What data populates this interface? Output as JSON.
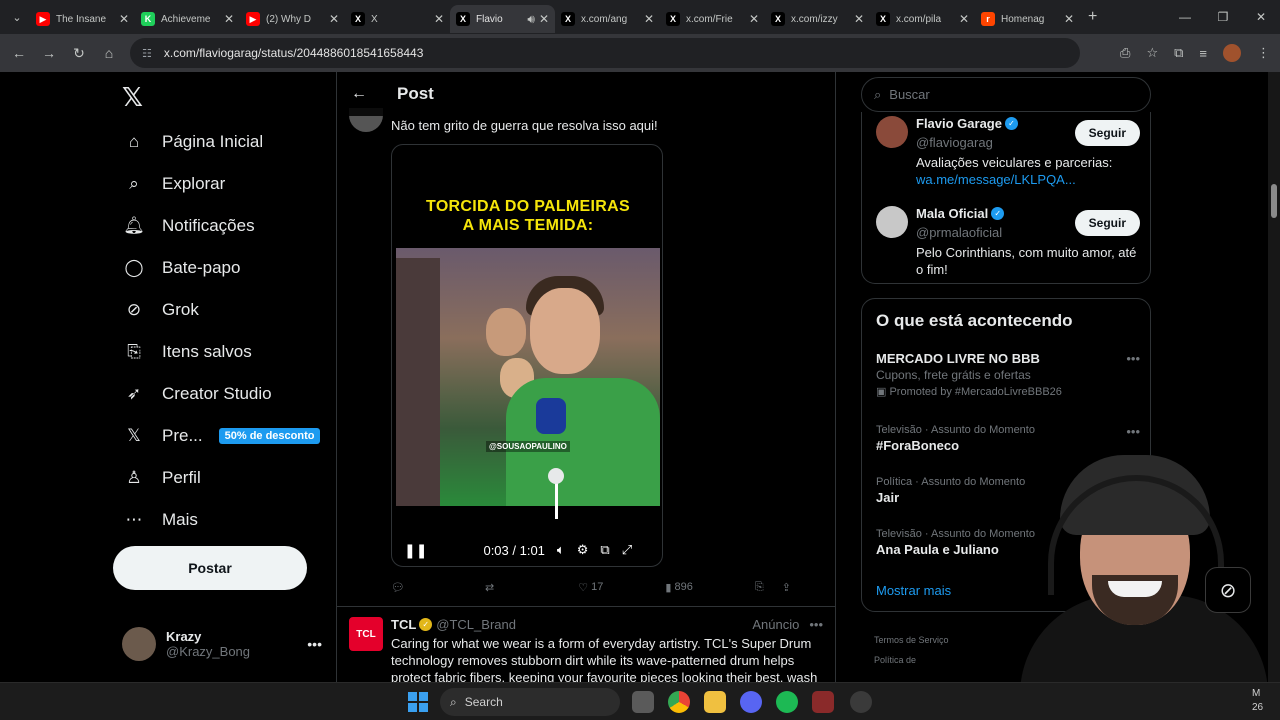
{
  "browser": {
    "tabs": [
      {
        "title": "The Insane",
        "fav": "yt",
        "color": "#ff0000"
      },
      {
        "title": "Achieveme",
        "fav": "K",
        "color": "#1fcf5a"
      },
      {
        "title": "(2) Why D",
        "fav": "yt",
        "color": "#ff0000"
      },
      {
        "title": "X",
        "fav": "X",
        "color": "#000000"
      },
      {
        "title": "Flavio",
        "fav": "X",
        "color": "#000000",
        "active": true
      },
      {
        "title": "x.com/ang",
        "fav": "X",
        "color": "#000000"
      },
      {
        "title": "x.com/Frie",
        "fav": "X",
        "color": "#000000"
      },
      {
        "title": "x.com/izzy",
        "fav": "X",
        "color": "#000000"
      },
      {
        "title": "x.com/pila",
        "fav": "X",
        "color": "#000000"
      },
      {
        "title": "Homenag",
        "fav": "r",
        "color": "#ff4500"
      }
    ],
    "url": "x.com/flaviogarag/status/2044886018541658443"
  },
  "nav": {
    "items": [
      {
        "label": "Página Inicial",
        "icon": "home-icon"
      },
      {
        "label": "Explorar",
        "icon": "search-icon"
      },
      {
        "label": "Notificações",
        "icon": "bell-icon"
      },
      {
        "label": "Bate-papo",
        "icon": "chat-icon"
      },
      {
        "label": "Grok",
        "icon": "grok-icon"
      },
      {
        "label": "Itens salvos",
        "icon": "bookmark-icon"
      },
      {
        "label": "Creator Studio",
        "icon": "rocket-icon"
      },
      {
        "label": "Pre...",
        "icon": "x-premium-icon",
        "badge": "50% de desconto"
      },
      {
        "label": "Perfil",
        "icon": "person-icon"
      },
      {
        "label": "Mais",
        "icon": "more-circle-icon"
      }
    ],
    "post_button": "Postar",
    "account": {
      "name": "Krazy",
      "handle": "@Krazy_Bong"
    }
  },
  "main": {
    "header_title": "Post",
    "tweet_text": "Não tem grito de guerra que resolva isso aqui!",
    "video": {
      "headline_line1": "TORCIDA DO PALMEIRAS",
      "headline_line2": "A MAIS TEMIDA:",
      "tag": "@SOUSAOPAULINO",
      "time": "0:03 / 1:01"
    },
    "actions": {
      "likes": "17",
      "views": "896"
    },
    "ad": {
      "logo": "TCL",
      "name": "TCL",
      "handle": "@TCL_Brand",
      "label": "Anúncio",
      "text": "Caring for what we wear is a form of everyday artistry. TCL's Super Drum technology removes stubborn dirt while its wave-patterned drum helps protect fabric fibers, keeping your favourite pieces looking their best, wash"
    }
  },
  "right": {
    "search_placeholder": "Buscar",
    "follow": [
      {
        "name": "Flavio Garage",
        "handle": "@flaviogarag",
        "bio": "Avaliações veiculares e parcerias:",
        "link": "wa.me/message/LKLPQA...",
        "button": "Seguir"
      },
      {
        "name": "Mala Oficial",
        "handle": "@prmalaoficial",
        "bio": "Pelo Corinthians, com muito amor, até o fim!",
        "button": "Seguir"
      }
    ],
    "trends_title": "O que está acontecendo",
    "trends": [
      {
        "title": "MERCADO LIVRE NO BBB",
        "sub": "Cupons, frete grátis e ofertas",
        "promo": "Promoted by #MercadoLivreBBB26"
      },
      {
        "context": "Televisão · Assunto do Momento",
        "title": "#ForaBoneco"
      },
      {
        "context": "Política · Assunto do Momento",
        "title": "Jair"
      },
      {
        "context": "Televisão · Assunto do Momento",
        "title": "Ana Paula e Juliano"
      }
    ],
    "show_more": "Mostrar mais",
    "footer": [
      "Termos de Serviço",
      "Política de"
    ]
  },
  "taskbar": {
    "search": "Search",
    "clock_line1": "M",
    "clock_line2": "26"
  }
}
